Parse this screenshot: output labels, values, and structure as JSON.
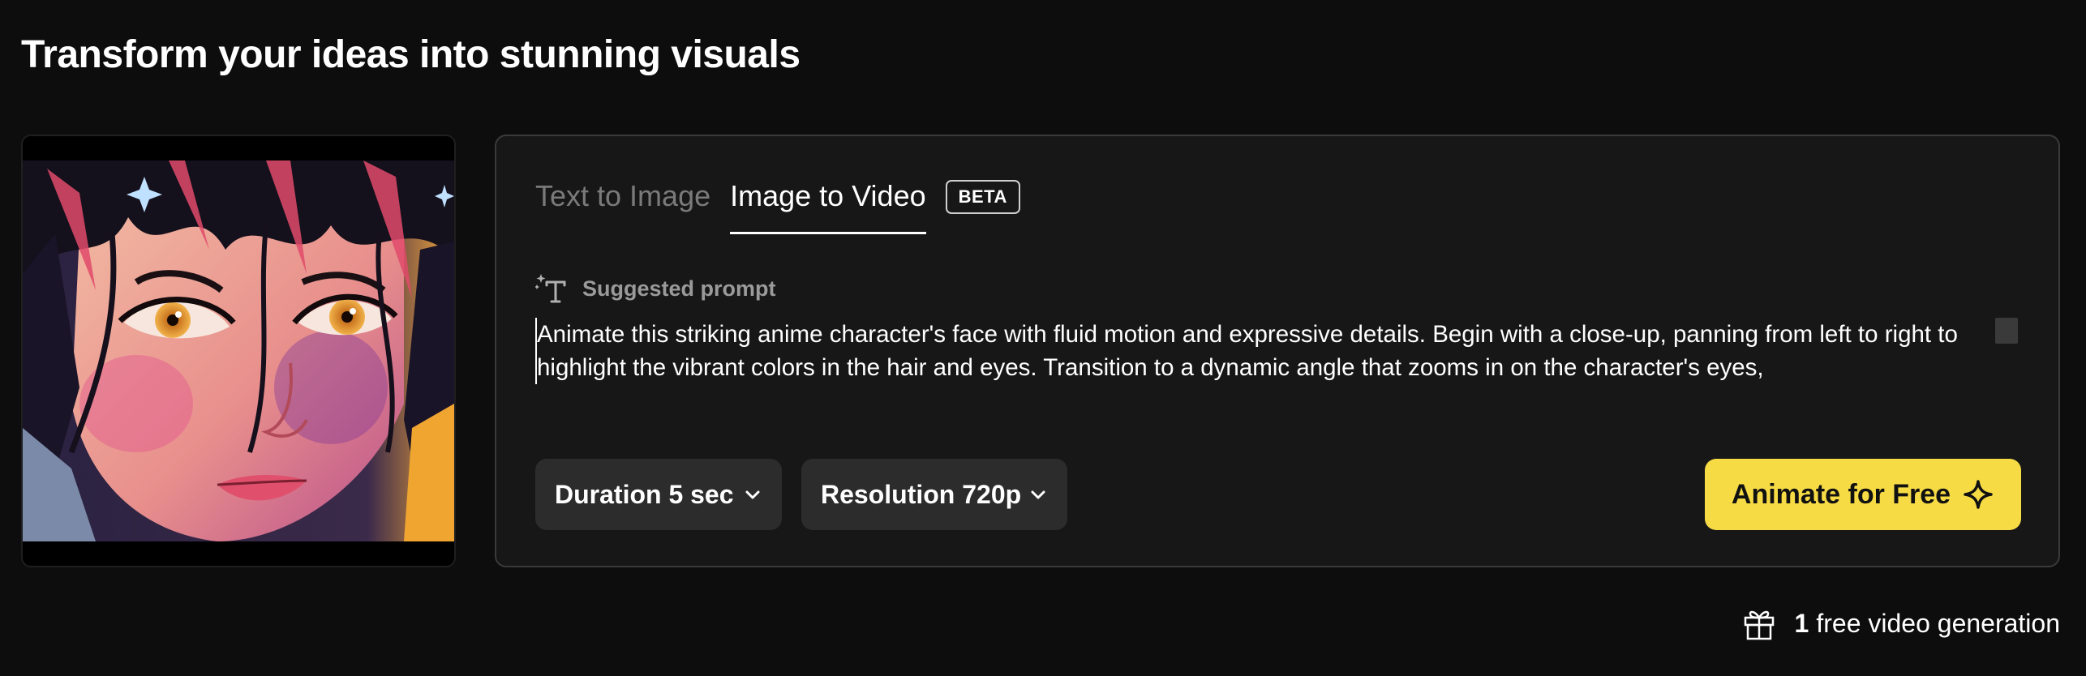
{
  "page_title": "Transform your ideas into stunning visuals",
  "preview": {
    "image_description": "anime character face with dark hair, amber eyes and pink highlights"
  },
  "tabs": [
    {
      "label": "Text to Image",
      "active": false
    },
    {
      "label": "Image to Video",
      "active": true
    }
  ],
  "beta_badge": "BETA",
  "suggested_prompt": {
    "icon": "sparkle-text-icon",
    "label": "Suggested prompt",
    "text": "Animate this striking anime character's face with fluid motion and expressive details. Begin with a close-up, panning from left to right to highlight the vibrant colors in the hair and eyes. Transition to a dynamic angle that zooms in on the character's eyes,"
  },
  "controls": {
    "duration_label": "Duration 5 sec",
    "resolution_label": "Resolution 720p",
    "animate_label": "Animate for Free"
  },
  "footer": {
    "free_count": "1",
    "free_text": "free video generation"
  },
  "colors": {
    "background": "#0d0d0d",
    "panel": "#171717",
    "accent_yellow": "#f6db45",
    "select_bg": "#2c2c2c"
  }
}
